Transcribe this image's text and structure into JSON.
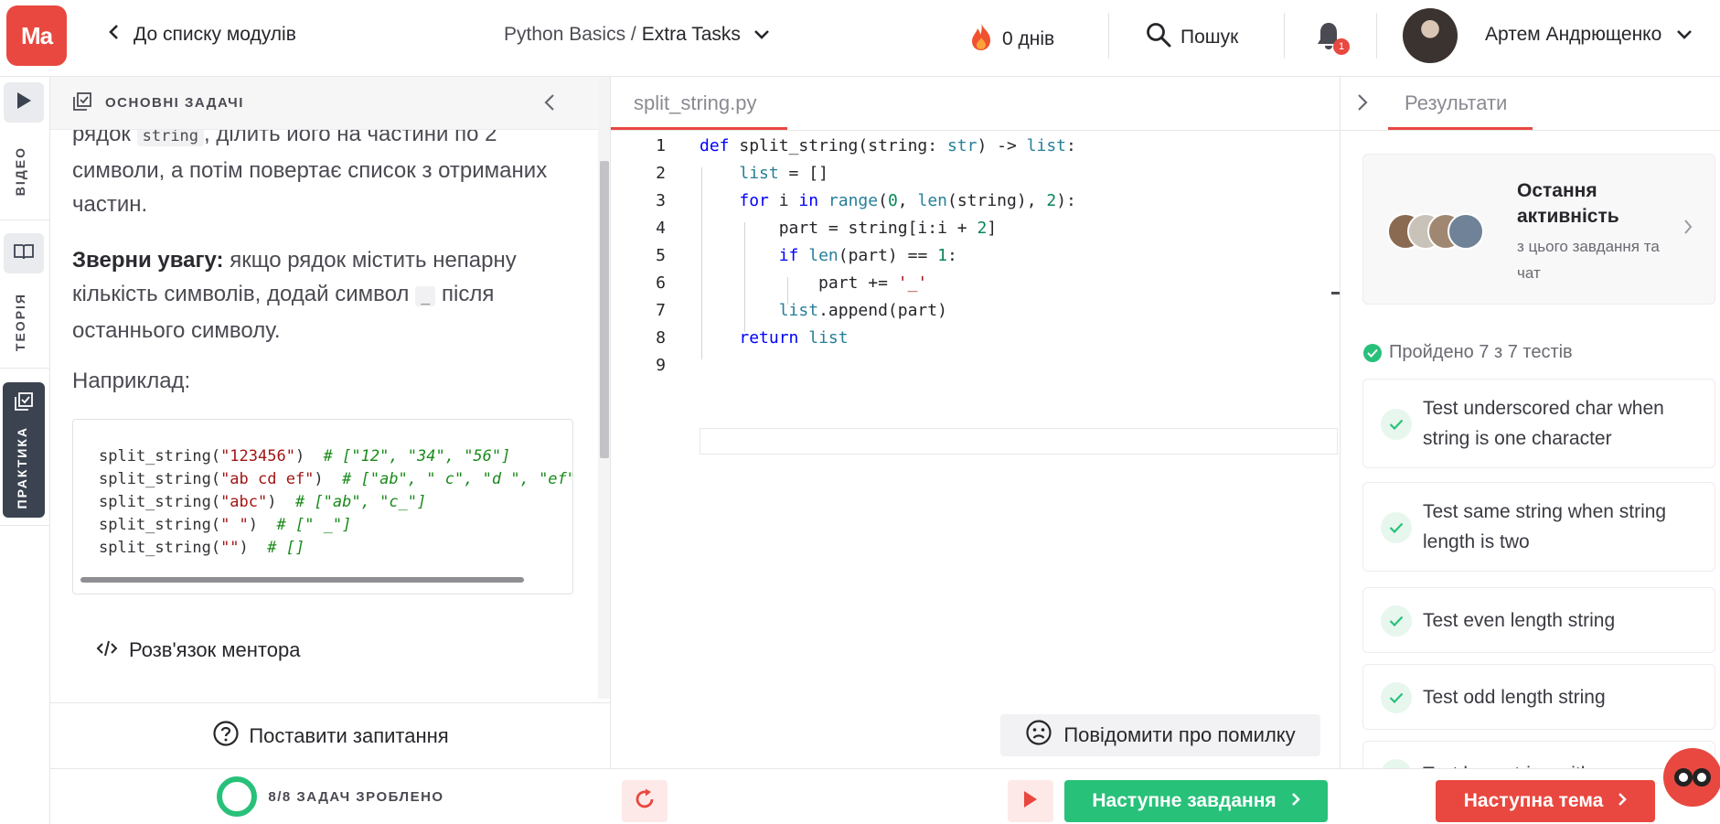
{
  "topbar": {
    "logo": "Ma",
    "back_label": "До списку модулів",
    "breadcrumb_course": "Python Basics /",
    "breadcrumb_section": "Extra Tasks",
    "streak": "0 днів",
    "search_label": "Пошук",
    "notifications_count": "1",
    "user_name": "Артем Андрющенко"
  },
  "siderail": {
    "video": "ВІДЕО",
    "theory": "ТЕОРІЯ",
    "practice": "ПРАКТИКА"
  },
  "task": {
    "header": "ОСНОВНІ ЗАДАЧІ",
    "p1_start": "рядок",
    "p1_code": "string",
    "p1_rest": ", ділить його на частини по 2 символи, а потім повертає список з отриманих частин.",
    "note_bold": "Зверни увагу:",
    "note_a": " якщо рядок містить непарну кількість символів, додай символ ",
    "note_code": "_",
    "note_b": " після останнього символу.",
    "example_label": "Наприклад:",
    "example_lines": [
      {
        "call": "split_string(",
        "arg": "\"123456\"",
        "close": ")  ",
        "comment": "# [\"12\", \"34\", \"56\"]"
      },
      {
        "call": "split_string(",
        "arg": "\"ab cd ef\"",
        "close": ")  ",
        "comment": "# [\"ab\", \" c\", \"d \", \"ef\"]"
      },
      {
        "call": "split_string(",
        "arg": "\"abc\"",
        "close": ")  ",
        "comment": "# [\"ab\", \"c_\"]"
      },
      {
        "call": "split_string(",
        "arg": "\" \"",
        "close": ")  ",
        "comment": "# [\" _\"]"
      },
      {
        "call": "split_string(",
        "arg": "\"\"",
        "close": ")  ",
        "comment": "# []"
      }
    ],
    "mentor_solution": "Розв'язок ментора",
    "ask_question": "Поставити запитання",
    "progress": "8/8 ЗАДАЧ ЗРОБЛЕНО"
  },
  "editor": {
    "filename": "split_string.py",
    "line_numbers": [
      "1",
      "2",
      "3",
      "4",
      "5",
      "6",
      "7",
      "8",
      "9"
    ],
    "report_bug": "Повідомити про помилку"
  },
  "results": {
    "tab": "Результати",
    "activity_title": "Остання активність",
    "activity_sub": "з цього завдання та чат",
    "passed": "Пройдено 7 з 7 тестів",
    "tests": [
      "Test underscored char when string is one character",
      "Test same string when string length is two",
      "Test even length string",
      "Test odd length string",
      "Test long string with even"
    ]
  },
  "bottom": {
    "next_task": "Наступне завдання",
    "next_topic": "Наступна тема"
  },
  "colors": {
    "brand": "#e8483f",
    "success": "#28c17a",
    "practice_active": "#3b4250"
  }
}
